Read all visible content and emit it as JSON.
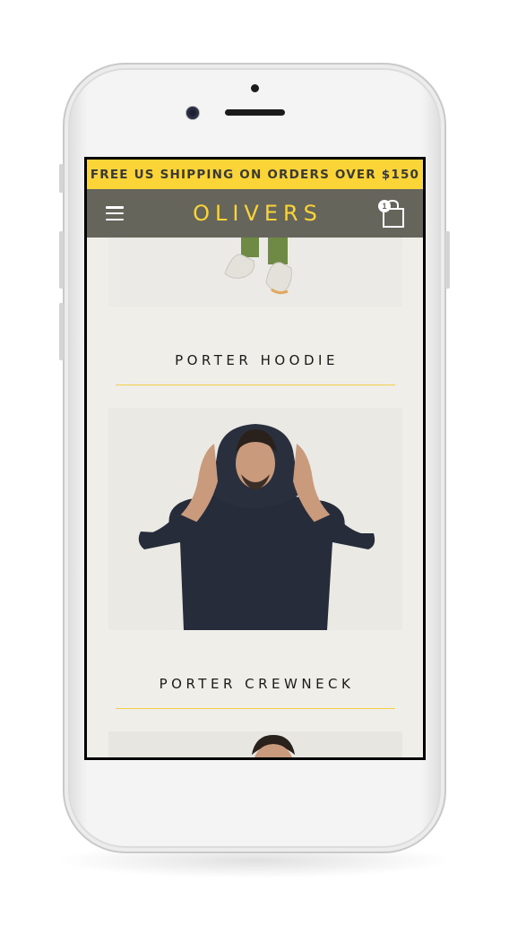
{
  "promo": {
    "text": "FREE US SHIPPING ON ORDERS OVER $150"
  },
  "header": {
    "brand": "OLIVERS",
    "cart_count": "1"
  },
  "products": [
    {
      "name": "PORTER HOODIE"
    },
    {
      "name": "PORTER CREWNECK"
    }
  ],
  "colors": {
    "promo_bg": "#fbd437",
    "nav_bg": "#65655b",
    "brand_text": "#fbd437",
    "page_bg": "#efeee8",
    "divider": "#f1cf4b"
  },
  "icons": {
    "menu": "hamburger-menu-icon",
    "cart": "shopping-bag-icon"
  }
}
